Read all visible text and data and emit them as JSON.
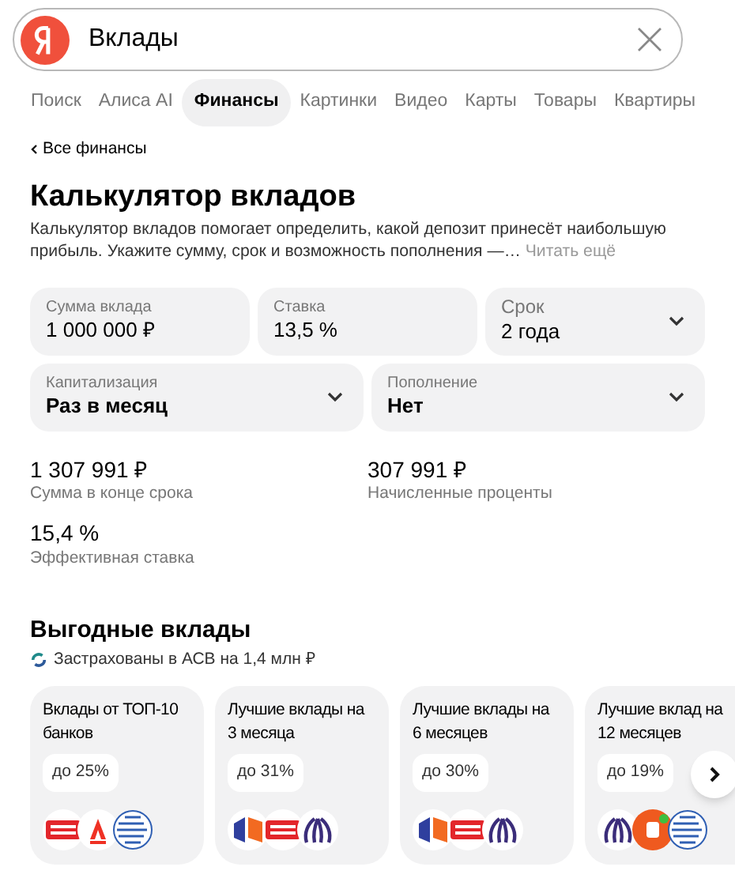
{
  "search": {
    "value": "Вклады"
  },
  "tabs": [
    {
      "label": "Поиск",
      "selected": false
    },
    {
      "label": "Алиса AI",
      "selected": false
    },
    {
      "label": "Финансы",
      "selected": true
    },
    {
      "label": "Картинки",
      "selected": false
    },
    {
      "label": "Видео",
      "selected": false
    },
    {
      "label": "Карты",
      "selected": false
    },
    {
      "label": "Товары",
      "selected": false
    },
    {
      "label": "Квартиры",
      "selected": false
    }
  ],
  "back_link": "Все финансы",
  "calculator": {
    "title": "Калькулятор вкладов",
    "description": "Калькулятор вкладов помогает определить, какой депозит принесёт наибольшую прибыль. Укажите сумму, срок и возможность пополнения —…",
    "read_more": "Читать ещё",
    "fields_row_1": [
      {
        "label": "Сумма вклада",
        "value": "1 000 000 ₽",
        "kind": "input"
      },
      {
        "label": "Ставка",
        "value": "13,5 %",
        "kind": "input"
      },
      {
        "label": "Срок",
        "value": "2 года",
        "kind": "select"
      }
    ],
    "fields_row_2": [
      {
        "label": "Капитализация",
        "value": "Раз в месяц",
        "kind": "select"
      },
      {
        "label": "Пополнение",
        "value": "Нет",
        "kind": "select"
      }
    ],
    "results": [
      {
        "value": "1 307 991 ₽",
        "label": "Сумма в конце срока"
      },
      {
        "value": "307 991 ₽",
        "label": "Начисленные проценты"
      },
      {
        "value": "15,4 %",
        "label": "Эффективная ставка"
      }
    ]
  },
  "offers": {
    "title": "Выгодные вклады",
    "subtitle": "Застрахованы в АСВ на 1,4 млн ₽",
    "cards": [
      {
        "title": "Вклады от ТОП-10 банков",
        "rate": "до 25%",
        "logos": [
          {
            "kind": "red"
          },
          {
            "kind": "alfa"
          },
          {
            "kind": "globe"
          }
        ]
      },
      {
        "title": "Лучшие вклады на 3 месяца",
        "rate": "до 31%",
        "logos": [
          {
            "kind": "orange-blue"
          },
          {
            "kind": "red"
          },
          {
            "kind": "stripes"
          }
        ]
      },
      {
        "title": "Лучшие вклады на 6 месяцев",
        "rate": "до 30%",
        "logos": [
          {
            "kind": "orange-blue"
          },
          {
            "kind": "red"
          },
          {
            "kind": "stripes"
          }
        ]
      },
      {
        "title": "Лучшие вклад на 12 месяцев",
        "rate": "до 19%",
        "logos": [
          {
            "kind": "stripes"
          },
          {
            "kind": "orange"
          },
          {
            "kind": "globe"
          }
        ]
      }
    ]
  }
}
